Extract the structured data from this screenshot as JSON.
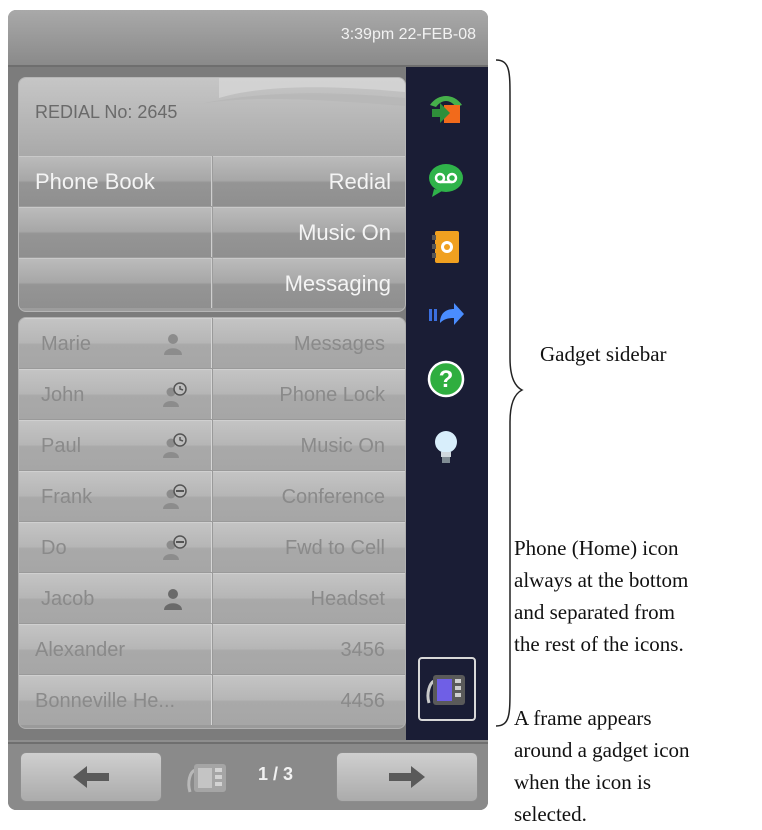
{
  "status_bar": {
    "datetime": "3:39pm 22-FEB-08"
  },
  "redial": {
    "text": "REDIAL No:  2645"
  },
  "top_grid": [
    {
      "left": "Phone Book",
      "right": "Redial"
    },
    {
      "left": "",
      "right": "Music On"
    },
    {
      "left": "",
      "right": "Messaging"
    }
  ],
  "contact_rows": [
    {
      "name": "Marie",
      "icon": "person-icon",
      "action": "Messages"
    },
    {
      "name": "John",
      "icon": "person-clock-icon",
      "action": "Phone Lock"
    },
    {
      "name": "Paul",
      "icon": "person-clock-icon",
      "action": "Music On"
    },
    {
      "name": "Frank",
      "icon": "person-busy-icon",
      "action": "Conference"
    },
    {
      "name": "Do",
      "icon": "person-busy-icon",
      "action": "Fwd to Cell"
    },
    {
      "name": "Jacob",
      "icon": "person-available-icon",
      "action": "Headset"
    },
    {
      "name": "Alexander",
      "icon": "",
      "action": "3456"
    },
    {
      "name": "Bonneville He...",
      "icon": "",
      "action": "4456"
    }
  ],
  "sidebar_icons": [
    "transfer-icon",
    "voicemail-icon",
    "address-book-icon",
    "forward-icon",
    "help-icon",
    "lightbulb-icon",
    "phone-home-icon"
  ],
  "pagination": {
    "page": "1 / 3"
  },
  "annotations": {
    "sidebar_label": "Gadget sidebar",
    "home_note": [
      "Phone (Home) icon",
      "always at the bottom",
      "and separated from",
      "the rest of the icons."
    ],
    "frame_note": [
      "A frame appears",
      "around a gadget icon",
      "when the icon is",
      "selected."
    ]
  }
}
